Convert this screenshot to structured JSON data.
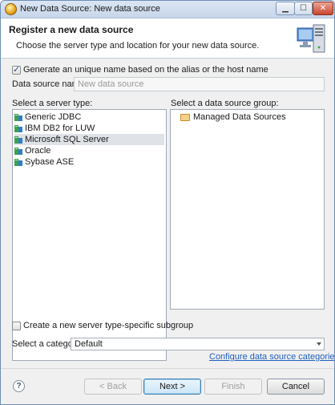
{
  "window": {
    "title": "New Data Source: New data source"
  },
  "banner": {
    "title": "Register a new data source",
    "description": "Choose the server type and location for your new data source.",
    "icon": "computer-server-icon"
  },
  "form": {
    "generate_name_label": "Generate an unique name based on the alias or the host name",
    "generate_name_checked": true,
    "data_source_name_label": "Data source name:",
    "data_source_name_placeholder": "New data source",
    "server_type_label": "Select a server type:",
    "server_types": [
      {
        "label": "Generic JDBC",
        "selected": false
      },
      {
        "label": "IBM DB2 for LUW",
        "selected": false
      },
      {
        "label": "Microsoft SQL Server",
        "selected": true
      },
      {
        "label": "Oracle",
        "selected": false
      },
      {
        "label": "Sybase ASE",
        "selected": false
      }
    ],
    "group_label": "Select a data source group:",
    "groups": [
      {
        "label": "Managed Data Sources"
      }
    ],
    "subgroup_label": "Create a new server type-specific subgroup",
    "subgroup_checked": false,
    "category_label": "Select a category:",
    "category_value": "Default",
    "configure_link": "Configure data source categories"
  },
  "footer": {
    "help": "?",
    "back": "< Back",
    "next": "Next >",
    "finish": "Finish",
    "cancel": "Cancel"
  }
}
